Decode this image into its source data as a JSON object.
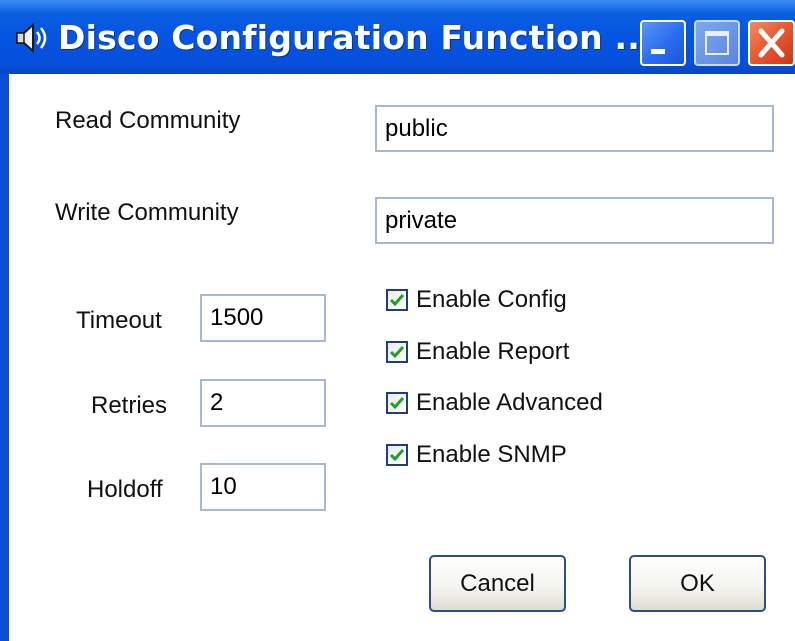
{
  "window": {
    "title": "Disco Configuration Function ...",
    "icon": "speaker-icon",
    "controls": {
      "minimize": "minimize-icon",
      "maximize": "maximize-icon",
      "close": "close-icon"
    }
  },
  "form": {
    "read_community": {
      "label": "Read Community",
      "value": "public"
    },
    "write_community": {
      "label": "Write Community",
      "value": "private"
    },
    "timeout": {
      "label": "Timeout",
      "value": "1500"
    },
    "retries": {
      "label": "Retries",
      "value": "2"
    },
    "holdoff": {
      "label": "Holdoff",
      "value": "10"
    }
  },
  "options": [
    {
      "label": "Enable Config",
      "checked": true
    },
    {
      "label": "Enable Report",
      "checked": true
    },
    {
      "label": "Enable Advanced",
      "checked": true
    },
    {
      "label": "Enable SNMP",
      "checked": true
    }
  ],
  "buttons": {
    "cancel": "Cancel",
    "ok": "OK"
  },
  "colors": {
    "titlebar": "#0654e2",
    "check_mark": "#21a121",
    "close_button": "#e4532a"
  }
}
